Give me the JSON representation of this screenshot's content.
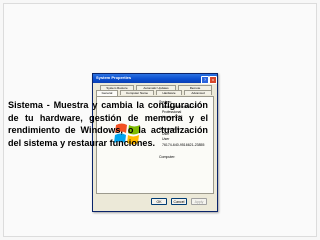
{
  "dialog": {
    "title": "System Properties",
    "help_glyph": "?",
    "close_glyph": "x",
    "tabs_row1": [
      "System Restore",
      "Automatic Updates",
      "Remote"
    ],
    "tabs_row2": [
      "General",
      "Computer Name",
      "Hardware",
      "Advanced"
    ],
    "active_tab": "General",
    "info": {
      "system_label": "System:",
      "os_name": "Microsoft Windows XP",
      "edition": "Professional",
      "version": "Version 2002",
      "registered_label": "Registered to:",
      "user1": "User",
      "user2": "User",
      "product_id": "76174-640-9516621-23855",
      "computer_label": "Computer:"
    },
    "buttons": {
      "ok": "OK",
      "cancel": "Cancel",
      "apply": "Apply"
    }
  },
  "caption": {
    "text": "Sistema - Muestra y cambia la configuración de tu hardware, gestión de memoria y el rendimiento de Windows, o la actualización del sistema y restaurar funciones."
  },
  "colors": {
    "titlebar": "#0a4fd1",
    "dialog_bg": "#ece9d8",
    "logo_red": "#f25022",
    "logo_green": "#7fba00",
    "logo_blue": "#00a4ef",
    "logo_yellow": "#ffb900"
  }
}
